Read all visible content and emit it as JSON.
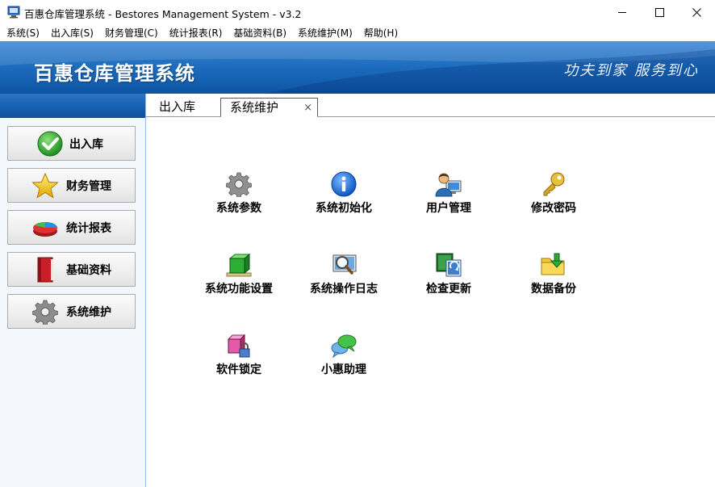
{
  "window": {
    "title": "百惠仓库管理系统 - Bestores Management System - v3.2"
  },
  "menu": [
    "系统(S)",
    "出入库(S)",
    "财务管理(C)",
    "统计报表(R)",
    "基础资料(B)",
    "系统维护(M)",
    "帮助(H)"
  ],
  "banner": {
    "title": "百惠仓库管理系统",
    "slogan": "功夫到家 服务到心"
  },
  "sidebar": {
    "items": [
      {
        "label": "出入库",
        "icon": "check-icon"
      },
      {
        "label": "财务管理",
        "icon": "star-icon"
      },
      {
        "label": "统计报表",
        "icon": "pie-chart-icon"
      },
      {
        "label": "基础资料",
        "icon": "book-icon"
      },
      {
        "label": "系统维护",
        "icon": "gear-icon"
      }
    ]
  },
  "tabs": [
    {
      "label": "出入库",
      "active": false
    },
    {
      "label": "系统维护",
      "active": true,
      "close": "×"
    }
  ],
  "functions": [
    {
      "label": "系统参数",
      "icon": "gear-icon"
    },
    {
      "label": "系统初始化",
      "icon": "info-icon"
    },
    {
      "label": "用户管理",
      "icon": "user-computer-icon"
    },
    {
      "label": "修改密码",
      "icon": "key-icon"
    },
    {
      "label": "系统功能设置",
      "icon": "green-cube-icon"
    },
    {
      "label": "系统操作日志",
      "icon": "magnifier-log-icon"
    },
    {
      "label": "检查更新",
      "icon": "update-icon"
    },
    {
      "label": "数据备份",
      "icon": "folder-download-icon"
    },
    {
      "label": "软件锁定",
      "icon": "lock-icon"
    },
    {
      "label": "小惠助理",
      "icon": "chat-bubbles-icon"
    }
  ],
  "colors": {
    "banner": "#1c6bbd",
    "sidebar_border": "#9bb9de"
  }
}
